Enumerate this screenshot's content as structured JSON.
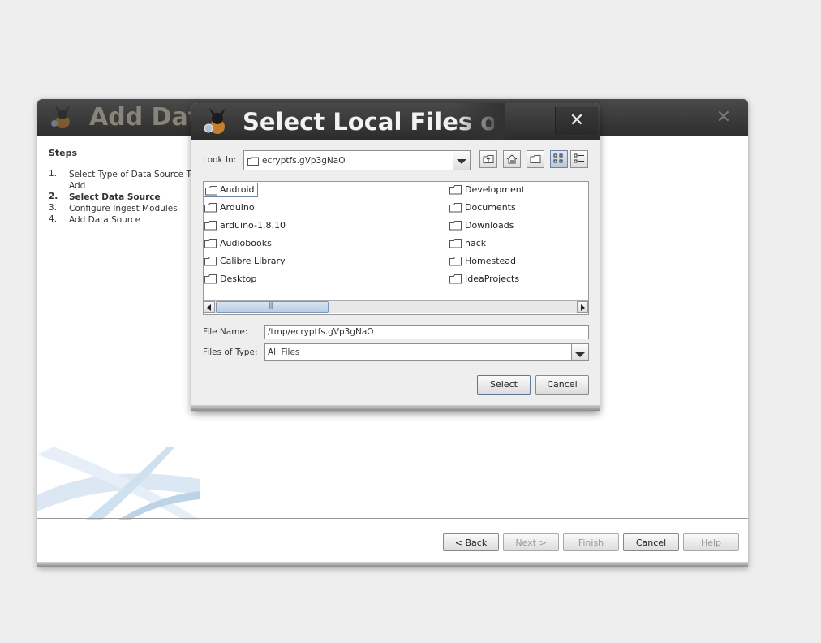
{
  "wizard": {
    "title": "Add Dat",
    "close_glyph": "✕",
    "steps_title": "Steps",
    "steps": [
      {
        "num": "1.",
        "label": "Select Type of Data Source To Add",
        "bold": false
      },
      {
        "num": "2.",
        "label": "Select Data Source",
        "bold": true
      },
      {
        "num": "3.",
        "label": "Configure Ingest Modules",
        "bold": false
      },
      {
        "num": "4.",
        "label": "Add Data Source",
        "bold": false
      }
    ],
    "buttons": {
      "back": "< Back",
      "next": "Next >",
      "finish": "Finish",
      "cancel": "Cancel",
      "help": "Help"
    }
  },
  "dialog": {
    "title": "Select Local Files or",
    "close_glyph": "✕",
    "look_in_label": "Look In:",
    "look_in_value": "ecryptfs.gVp3gNaO",
    "toolbar_icons": [
      "up-folder-icon",
      "home-icon",
      "new-folder-icon",
      "list-view-icon",
      "details-view-icon"
    ],
    "files_left": [
      "Android",
      "Arduino",
      "arduino-1.8.10",
      "Audiobooks",
      "Calibre Library",
      "Desktop"
    ],
    "files_right": [
      "Development",
      "Documents",
      "Downloads",
      "hack",
      "Homestead",
      "IdeaProjects"
    ],
    "file_name_label": "File Name:",
    "file_name_value": "/tmp/ecryptfs.gVp3gNaO",
    "files_of_type_label": "Files of Type:",
    "files_of_type_value": "All Files",
    "select_button": "Select",
    "cancel_button": "Cancel"
  }
}
